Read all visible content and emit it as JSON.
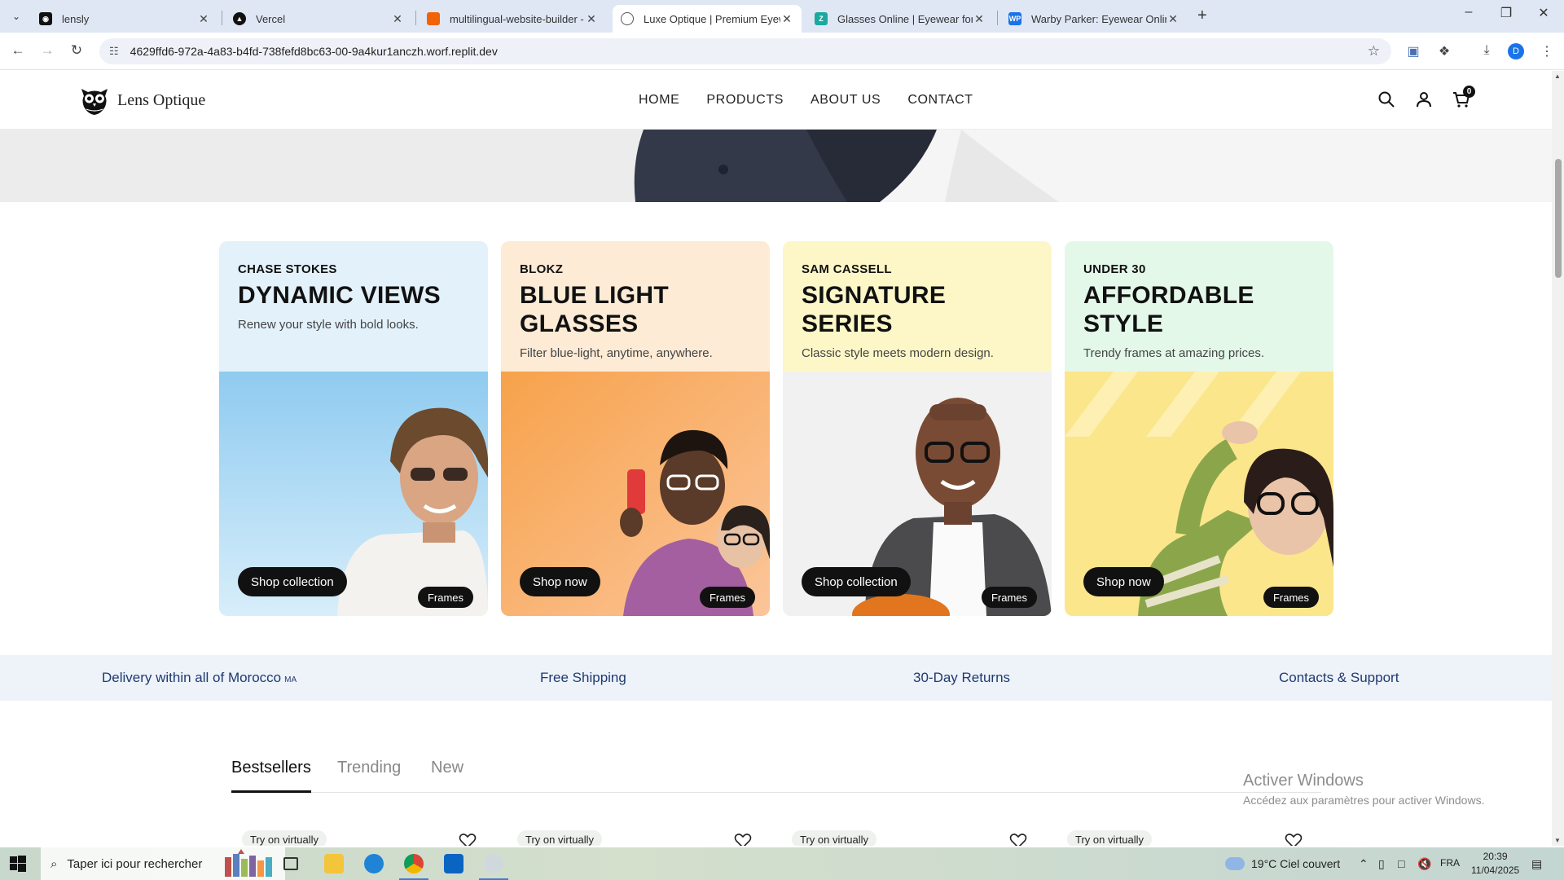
{
  "browser": {
    "tabs": [
      {
        "title": "lensly",
        "icon": "github-icon",
        "color": "#111111"
      },
      {
        "title": "Vercel",
        "icon": "vercel-icon",
        "color": "#111111"
      },
      {
        "title": "multilingual-website-builder - F",
        "icon": "replit-icon",
        "color": "#f26207"
      },
      {
        "title": "Luxe Optique | Premium Eyewe",
        "icon": "globe-icon",
        "color": "#555555",
        "active": true
      },
      {
        "title": "Glasses Online | Eyewear for Ev",
        "icon": "zenni-icon",
        "color": "#1aa99f"
      },
      {
        "title": "Warby Parker: Eyewear Online",
        "icon": "wp-icon",
        "color": "#1a73e8"
      }
    ],
    "url": "4629ffd6-972a-4a83-b4fd-738fefd8bc63-00-9a4kur1anczh.worf.replit.dev",
    "profile_initial": "D"
  },
  "site": {
    "brand": "Lens Optique",
    "nav": [
      "HOME",
      "PRODUCTS",
      "ABOUT US",
      "CONTACT"
    ],
    "cart_count": "0"
  },
  "collections": [
    {
      "eyebrow": "CHASE STOKES",
      "title": "DYNAMIC VIEWS",
      "subtitle": "Renew your style with bold looks.",
      "button": "Shop collection",
      "tag": "Frames",
      "bg": "#e3f1fb"
    },
    {
      "eyebrow": "BLOKZ",
      "title": "BLUE LIGHT GLASSES",
      "subtitle": "Filter blue-light, anytime, anywhere.",
      "button": "Shop now",
      "tag": "Frames",
      "bg": "#fdebd6"
    },
    {
      "eyebrow": "SAM CASSELL",
      "title": "SIGNATURE SERIES",
      "subtitle": "Classic style meets modern design.",
      "button": "Shop collection",
      "tag": "Frames",
      "bg": "#fdf7c8"
    },
    {
      "eyebrow": "UNDER 30",
      "title": "AFFORDABLE STYLE",
      "subtitle": "Trendy frames at amazing prices.",
      "button": "Shop now",
      "tag": "Frames",
      "bg": "#e3f8e9"
    }
  ],
  "benefits": [
    {
      "text": "Delivery within all of Morocco",
      "suffix": "MA"
    },
    {
      "text": "Free Shipping"
    },
    {
      "text": "30-Day Returns"
    },
    {
      "text": "Contacts & Support"
    }
  ],
  "product_tabs": [
    "Bestsellers",
    "Trending",
    "New"
  ],
  "product_badge": "Try on virtually",
  "watermark": {
    "line1": "Activer Windows",
    "line2": "Accédez aux paramètres pour activer Windows."
  },
  "taskbar": {
    "search_placeholder": "Taper ici pour rechercher",
    "weather": "19°C  Ciel couvert",
    "lang": "FRA",
    "time": "20:39",
    "date": "11/04/2025"
  }
}
